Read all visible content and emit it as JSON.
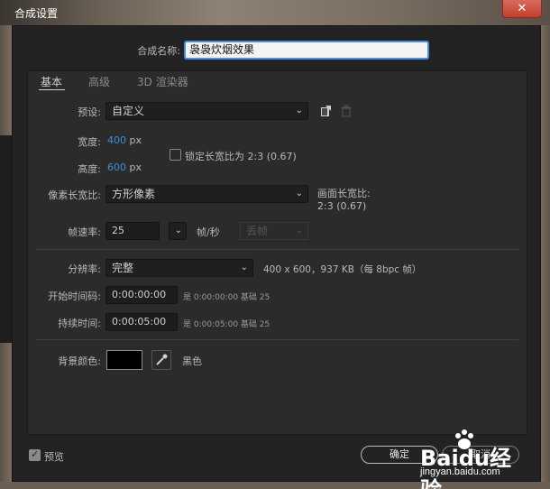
{
  "window": {
    "title": "合成设置",
    "close_label": "✕"
  },
  "comp": {
    "name_label": "合成名称:",
    "name_value": "袅袅炊烟效果"
  },
  "tabs": [
    {
      "label": "基本",
      "active": true
    },
    {
      "label": "高级",
      "active": false
    },
    {
      "label": "3D 渲染器",
      "active": false
    }
  ],
  "basic": {
    "preset_label": "预设:",
    "preset_value": "自定义",
    "width_label": "宽度:",
    "width_value": "400",
    "width_unit": "px",
    "height_label": "高度:",
    "height_value": "600",
    "height_unit": "px",
    "lock_aspect_label": "锁定长宽比为 2:3 (0.67)",
    "lock_aspect_checked": false,
    "pixel_aspect_label": "像素长宽比:",
    "pixel_aspect_value": "方形像素",
    "frame_aspect_label": "画面长宽比:",
    "frame_aspect_value": "2:3 (0.67)",
    "frame_rate_label": "帧速率:",
    "frame_rate_value": "25",
    "frame_rate_unit": "帧/秒",
    "drop_frame_value": "丢帧",
    "resolution_label": "分辨率:",
    "resolution_value": "完整",
    "resolution_info": "400 x 600，937 KB（每 8bpc 帧）",
    "start_timecode_label": "开始时间码:",
    "start_timecode_value": "0:00:00:00",
    "start_timecode_info": "是 0:00:00:00  基础 25",
    "duration_label": "持续时间:",
    "duration_value": "0:00:05:00",
    "duration_info": "是 0:00:05:00  基础 25",
    "bg_color_label": "背景颜色:",
    "bg_color_name": "黑色",
    "bg_color_hex": "#000000"
  },
  "footer": {
    "preview_label": "预览",
    "preview_checked": true,
    "ok_label": "确定",
    "cancel_label": "取消"
  },
  "watermark": {
    "brand": "Baidu经验",
    "url": "jingyan.baidu.com"
  },
  "colors": {
    "dialog_bg": "#232323",
    "panel_bg": "#2b2b2b",
    "accent_blue": "#3d8fd6",
    "close_red": "#c23e2e"
  }
}
